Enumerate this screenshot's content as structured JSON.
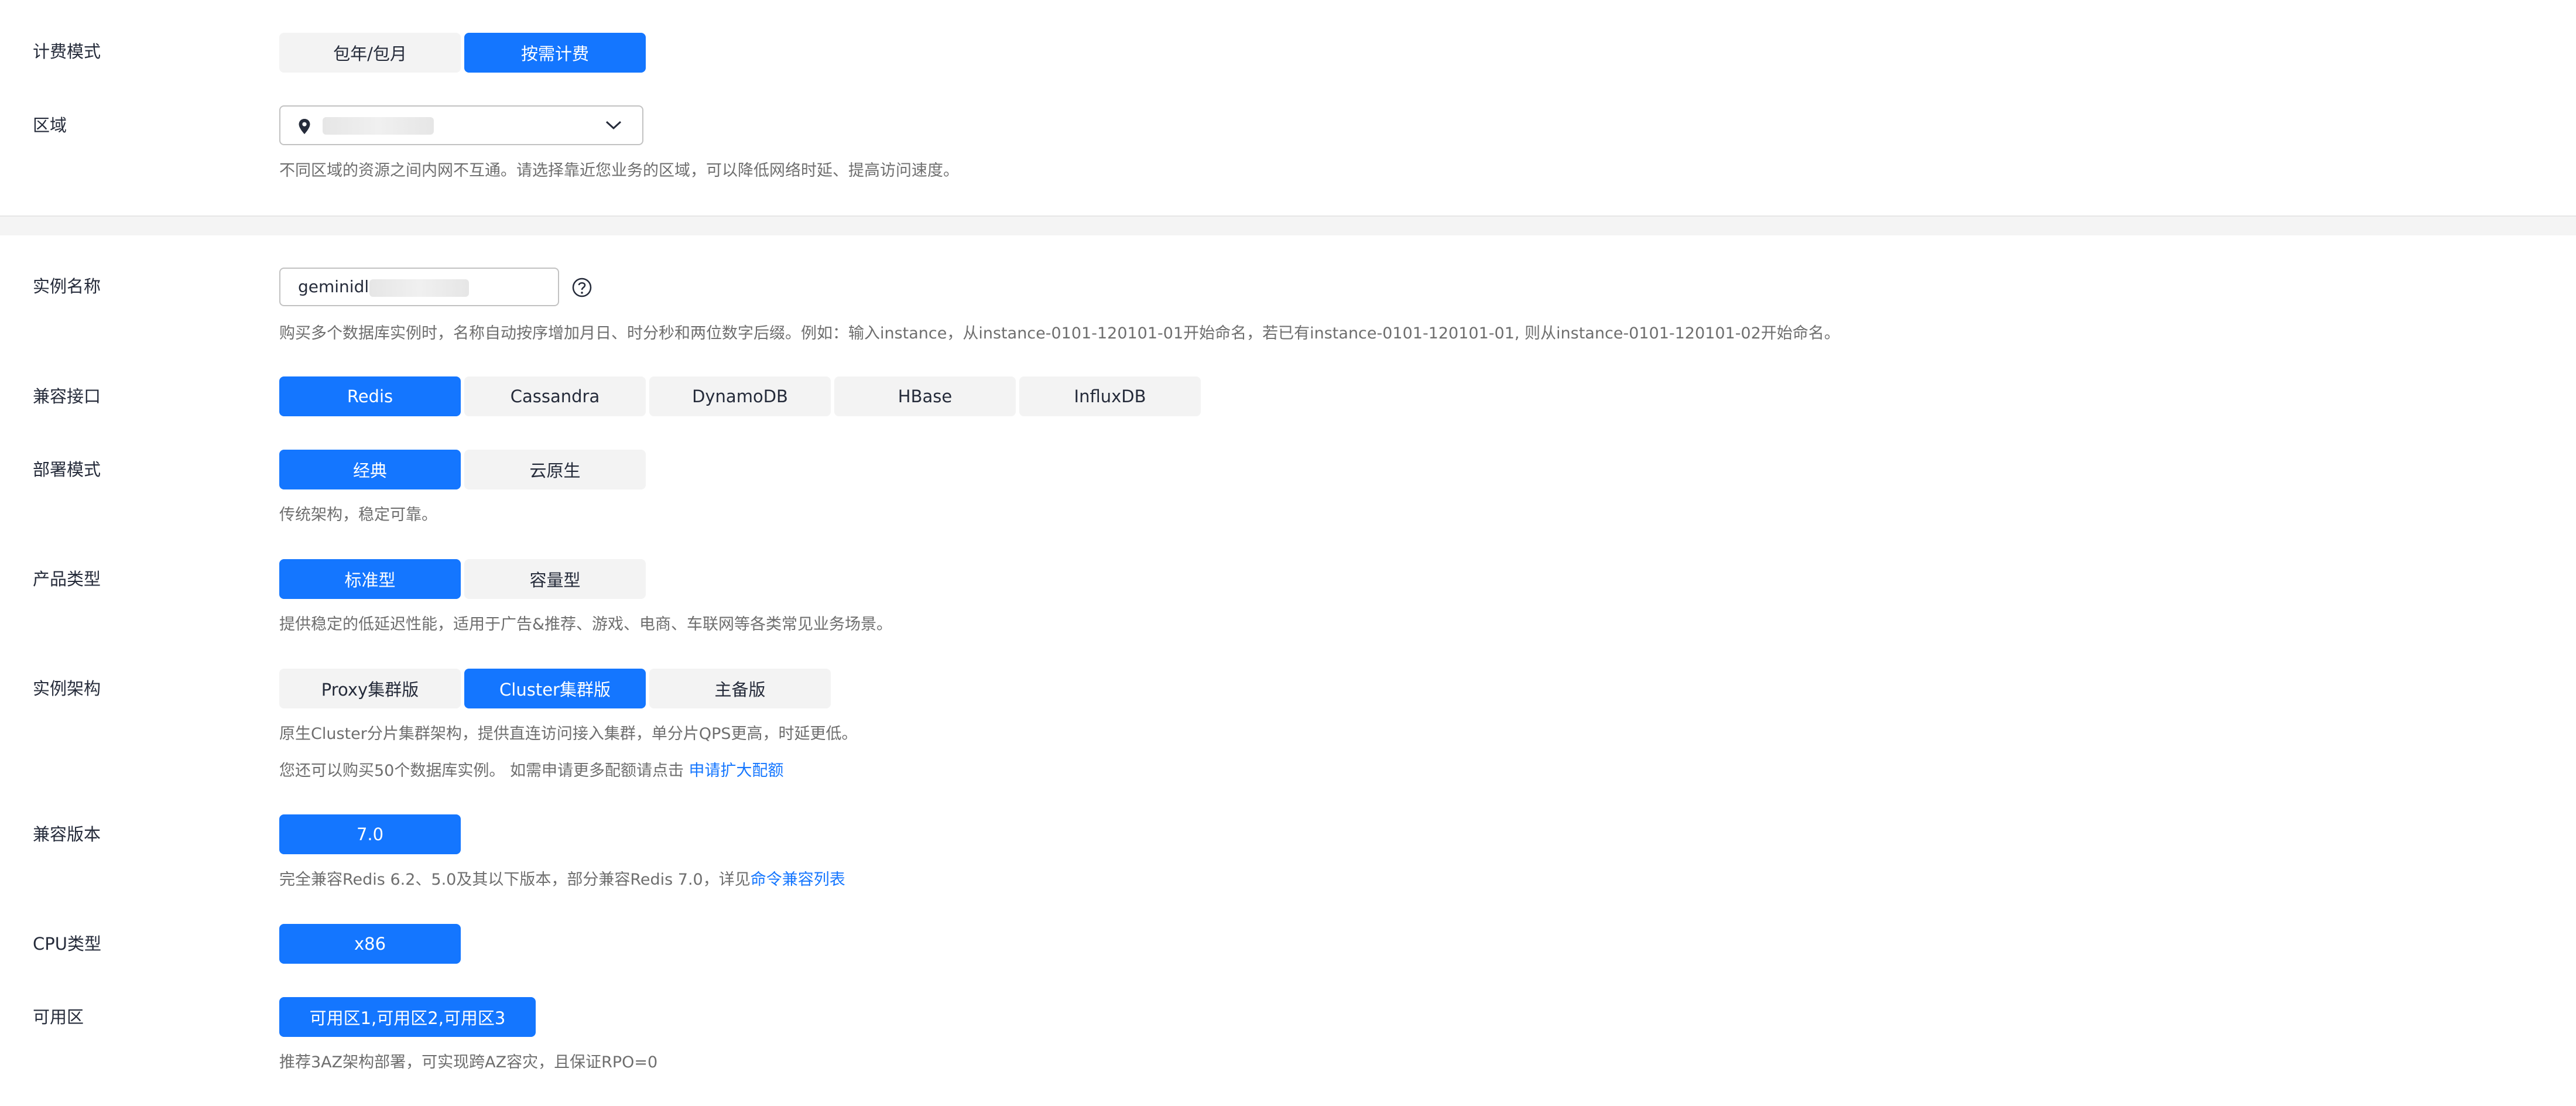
{
  "billing": {
    "label": "计费模式",
    "options": [
      "包年/包月",
      "按需计费"
    ]
  },
  "region": {
    "label": "区域",
    "hint": "不同区域的资源之间内网不互通。请选择靠近您业务的区域，可以降低网络时延、提高访问速度。"
  },
  "instance_name": {
    "label": "实例名称",
    "value": "geminidl",
    "hint": "购买多个数据库实例时，名称自动按序增加月日、时分秒和两位数字后缀。例如：输入instance，从instance-0101-120101-01开始命名，若已有instance-0101-120101-01, 则从instance-0101-120101-02开始命名。"
  },
  "api": {
    "label": "兼容接口",
    "options": [
      "Redis",
      "Cassandra",
      "DynamoDB",
      "HBase",
      "InfluxDB"
    ]
  },
  "deploy": {
    "label": "部署模式",
    "options": [
      "经典",
      "云原生"
    ],
    "hint": "传统架构，稳定可靠。"
  },
  "product": {
    "label": "产品类型",
    "options": [
      "标准型",
      "容量型"
    ],
    "hint": "提供稳定的低延迟性能，适用于广告&推荐、游戏、电商、车联网等各类常见业务场景。"
  },
  "arch": {
    "label": "实例架构",
    "options": [
      "Proxy集群版",
      "Cluster集群版",
      "主备版"
    ],
    "hint1": "原生Cluster分片集群架构，提供直连访问接入集群，单分片QPS更高，时延更低。",
    "hint2": "您还可以购买50个数据库实例。 如需申请更多配额请点击 ",
    "hint2_link": "申请扩大配额"
  },
  "version": {
    "label": "兼容版本",
    "value": "7.0",
    "hint": "完全兼容Redis 6.2、5.0及其以下版本，部分兼容Redis 7.0，详见",
    "hint_link": "命令兼容列表"
  },
  "cpu": {
    "label": "CPU类型",
    "value": "x86"
  },
  "az": {
    "label": "可用区",
    "value": "可用区1,可用区2,可用区3",
    "hint": "推荐3AZ架构部署，可实现跨AZ容灾，且保证RPO=0"
  },
  "colors": {
    "accent": "#1476ff",
    "inactive": "#f3f3f3"
  }
}
